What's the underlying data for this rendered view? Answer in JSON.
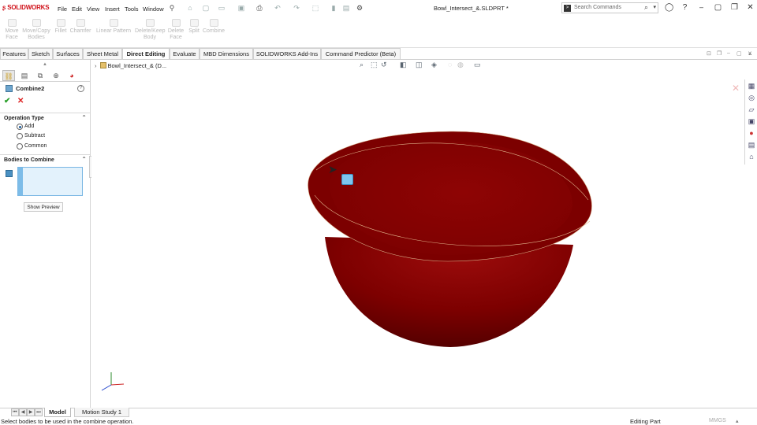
{
  "titlebar": {
    "logo": "SOLIDWORKS",
    "menus": [
      "File",
      "Edit",
      "View",
      "Insert",
      "Tools",
      "Window"
    ],
    "document_title": "Bowl_Intersect_&.SLDPRT *",
    "search_placeholder": "Search Commands"
  },
  "command_manager": {
    "commands": [
      {
        "label": "Move\nFace"
      },
      {
        "label": "Move/Copy\nBodies"
      },
      {
        "label": "Fillet"
      },
      {
        "label": "Chamfer"
      },
      {
        "label": "Linear Pattern"
      },
      {
        "label": "Delete/Keep\nBody"
      },
      {
        "label": "Delete\nFace"
      },
      {
        "label": "Split"
      },
      {
        "label": "Combine"
      }
    ]
  },
  "tabs": {
    "items": [
      "Features",
      "Sketch",
      "Surfaces",
      "Sheet Metal",
      "Direct Editing",
      "Evaluate",
      "MBD Dimensions",
      "SOLIDWORKS Add-Ins",
      "Command Predictor (Beta)"
    ],
    "active": "Direct Editing"
  },
  "property_manager": {
    "title": "Combine2",
    "operation_group": {
      "title": "Operation Type",
      "options": [
        "Add",
        "Subtract",
        "Common"
      ],
      "selected": "Add"
    },
    "bodies_group": {
      "title": "Bodies to Combine",
      "preview_button": "Show Preview"
    }
  },
  "viewport": {
    "tree_root_label": "Bowl_Intersect_& (D...",
    "model_color": "#8b0000"
  },
  "bottom_tabs": {
    "items": [
      "Model",
      "Motion Study 1"
    ],
    "active": "Model"
  },
  "status_bar": {
    "message": "Select bodies to be used in the combine operation.",
    "mode": "Editing Part",
    "units": "MMGS"
  }
}
